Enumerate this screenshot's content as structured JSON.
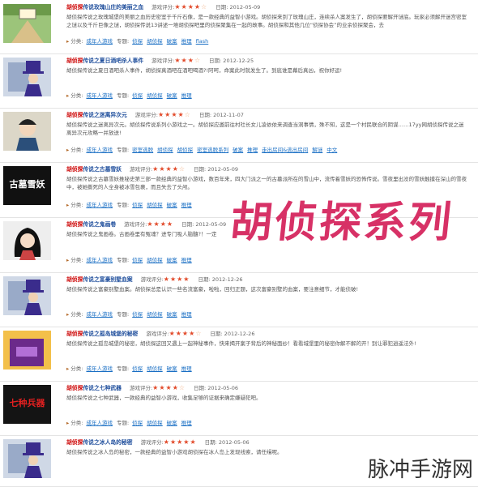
{
  "games": [
    {
      "title_prefix": "胡侦探",
      "title_rest": "传说玫瑰山庄的美丽之血",
      "rating_label": "游戏评分:",
      "stars_on": 4,
      "stars_off": 1,
      "date": "日期: 2012-05-09",
      "desc": "胡侦探传说之玫瑰城堡的美丽之血历史密室于千斤石像，是一款经典的益智小游戏。胡侦探来到了玫瑰山庄，连续杀人案发生了，胡侦探要解开谜底。玩家必须解开迷宫密室之谜以及千斤巨像之谜，胡侦探传说13讲述一堆胡侦探吧里的侦探聚集在一起的故事。胡侦探和其他几位“侦探协会”的业余侦探聚会，去",
      "tags_label": "分类:",
      "tags": [
        "成年人游戏",
        "专题:",
        "侦探",
        "胡侦探",
        "破案",
        "推理",
        "flash"
      ],
      "thumb": "forest"
    },
    {
      "title_prefix": "胡侦探",
      "title_rest": "传说之夏日酒吧杀人事件",
      "rating_label": "游戏评分:",
      "stars_on": 3,
      "stars_off": 1,
      "date": "日期: 2012-12-25",
      "desc": "胡侦探传说之夏日酒吧杀人事件，胡侦探真酒吧在酒吧喝酒?!阿呵，命案此时就发生了。到底谁是幕后真凶，祝你好运!",
      "tags_label": "分类:",
      "tags": [
        "成年人游戏",
        "专题:",
        "侦探",
        "胡侦探",
        "破案",
        "推理"
      ],
      "thumb": "tophat"
    },
    {
      "title_prefix": "胡侦探",
      "title_rest": "传说之迷离异次元",
      "rating_label": "游戏评分:",
      "stars_on": 4,
      "stars_off": 1,
      "date": "日期: 2012-11-07",
      "desc": "胡侦探传说之迷离异次元。胡侦探传说系列小游戏之一。胡侦探应邀前往村社长女儿凌依依来调查当洞事情，殊不知，这是一个村民联合的阴谋……17yy网胡侦探传说之迷离异次元攻略一并放送!",
      "tags_label": "分类:",
      "tags": [
        "成年人游戏",
        "专题:",
        "密室逃脱",
        "胡侦探",
        "胡侦探",
        "密室逃脱系列",
        "破案",
        "推理",
        "走出房间&逃出房间",
        "解谜",
        "中文"
      ],
      "thumb": "boy"
    },
    {
      "title_prefix": "胡侦探",
      "title_rest": "传说之古墓雪妖",
      "rating_label": "游戏评分:",
      "stars_on": 4,
      "stars_off": 1,
      "date": "日期: 2012-05-09",
      "desc": "胡侦探传说之古墓雪妖推秘史第三部一款经典的益智小游戏，数百年来，四大门派之一的古墓派所在的雪山中，流传着雪妖的恐怖传说。雪夜里出没的雪妖触摸在深山的雪夜中，被她撕死的人全身被冰雪包裹，而且失去了头颅。",
      "tags_label": "分类:",
      "tags": [
        "成年人游戏",
        "专题:",
        "侦探",
        "胡侦探",
        "破案",
        "推理"
      ],
      "thumb": "gumu",
      "thumb_text": "古墓雪妖"
    },
    {
      "title_prefix": "胡侦探",
      "title_rest": "传说之鬼画卷",
      "rating_label": "游戏评分:",
      "stars_on": 4,
      "stars_off": 0,
      "date": "日期: 2012-05-09",
      "desc": "胡侦探传说之鬼画卷。古画卷里有冤魂？进专门吸人脑髓?！一定",
      "tags_label": "分类:",
      "tags": [
        "成年人游戏",
        "专题:",
        "侦探",
        "胡侦探",
        "破案",
        "推理"
      ],
      "thumb": "woman"
    },
    {
      "title_prefix": "胡侦探",
      "title_rest": "传说之富豪别墅血案",
      "rating_label": "游戏评分:",
      "stars_on": 4,
      "stars_off": 0,
      "date": "日期: 2012-12-26",
      "desc": "胡侦探传说之富豪别墅血案。胡侦探总是认识一些名流富豪，啦啦，回归正题，这次富豪别墅的血案，要注意细节，才能侦破!",
      "tags_label": "分类:",
      "tags": [
        "成年人游戏",
        "专题:",
        "侦探",
        "胡侦探",
        "破案",
        "推理"
      ],
      "thumb": "tophat"
    },
    {
      "title_prefix": "胡侦探",
      "title_rest": "传说之孤岛城堡的秘密",
      "rating_label": "游戏评分:",
      "stars_on": 4,
      "stars_off": 1,
      "date": "日期: 2012-12-26",
      "desc": "胡侦探传说之孤岛城堡的秘密，胡侦探这回又遇上一起神秘事件，快来揭开案子背后的神秘面纱！看看城堡里的秘密你解不解的开！别让罪犯逍遥法外!",
      "tags_label": "分类:",
      "tags": [
        "成年人游戏",
        "专题:",
        "侦探",
        "胡侦探",
        "破案",
        "推理"
      ],
      "thumb": "purple"
    },
    {
      "title_prefix": "胡侦探",
      "title_rest": "传说之七种武器",
      "rating_label": "游戏评分:",
      "stars_on": 4,
      "stars_off": 1,
      "date": "日期: 2012-05-06",
      "desc": "胡侦探传说之七种武器，一款经典的益智小游戏，收集足够的证据来确定嫌疑犯吧。",
      "tags_label": "分类:",
      "tags": [
        "成年人游戏",
        "专题:",
        "侦探",
        "胡侦探",
        "破案",
        "推理"
      ],
      "thumb": "qizhong",
      "thumb_text": "七种兵器"
    },
    {
      "title_prefix": "胡侦探",
      "title_rest": "传说之冰人岛的秘密",
      "rating_label": "游戏评分:",
      "stars_on": 5,
      "stars_off": 0,
      "date": "日期: 2012-05-06",
      "desc": "胡侦探传说之冰人岛的秘密，一款经典的益智小游戏胡侦探在冰人岛上发现线索，请任缉呢。",
      "tags_label": "分类:",
      "tags": [],
      "thumb": "tophat"
    }
  ],
  "watermark": "胡侦探系列",
  "site_mark": "脉冲手游网"
}
